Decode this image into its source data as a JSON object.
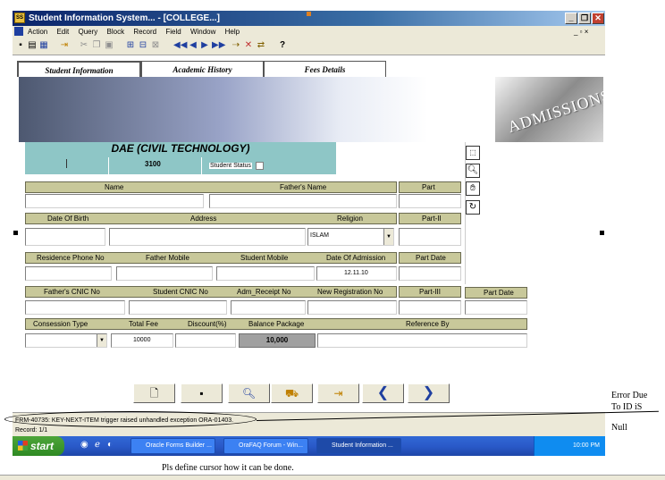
{
  "window": {
    "title": "Student Information System... - [COLLEGE...]",
    "buttons": [
      "_",
      "❐",
      "✕"
    ]
  },
  "menu": {
    "items": [
      "Action",
      "Edit",
      "Query",
      "Block",
      "Record",
      "Field",
      "Window",
      "Help"
    ],
    "mdi_controls": "_ ▫ ×"
  },
  "tabs": [
    {
      "label": "Student Information"
    },
    {
      "label": "Academic History"
    },
    {
      "label": "Fees Details"
    }
  ],
  "banner": {
    "image_text": "ADMISSIONS"
  },
  "program": {
    "title": "DAE (CIVIL TECHNOLOGY)",
    "code": "3100",
    "status_label": "Student Status"
  },
  "row1": {
    "name": "Name",
    "father_name": "Father's Name",
    "part": "Part"
  },
  "row2": {
    "dob": "Date Of Birth",
    "address": "Address",
    "religion": "Religion",
    "religion_value": "ISLAM",
    "part2": "Part-II"
  },
  "row3": {
    "res_phone": "Residence Phone No",
    "father_mobile": "Father Mobile",
    "student_mobile": "Student Mobile",
    "date_admission": "Date Of Admission",
    "date_admission_value": "12.11.10",
    "part_date": "Part Date"
  },
  "row4": {
    "father_cnic": "Father's CNIC No",
    "student_cnic": "Student CNIC No",
    "adm_receipt": "Adm_Receipt No",
    "new_reg": "New Registration No",
    "part3": "Part-III",
    "part_date": "Part Date"
  },
  "row5": {
    "concession": "Consession Type",
    "total_fee": "Total Fee",
    "discount": "Discount(%)",
    "balance": "Balance Package",
    "reference": "Reference By",
    "total_fee_value": "10000",
    "balance_value": "10,000"
  },
  "status": {
    "error": "FRM-40735: KEY-NEXT-ITEM trigger raised unhandled exception ORA-01403.",
    "record": "Record: 1/1"
  },
  "taskbar": {
    "start": "start",
    "tasks": [
      "Oracle Forms Builder ...",
      "OraFAQ Forum - Win...",
      "Student Information ..."
    ],
    "clock": "10:00 PM"
  },
  "annotations": {
    "side_note": [
      "Error Due",
      "To ID iS",
      "Null"
    ],
    "bottom_note": "Pls define cursor how it can be done."
  }
}
